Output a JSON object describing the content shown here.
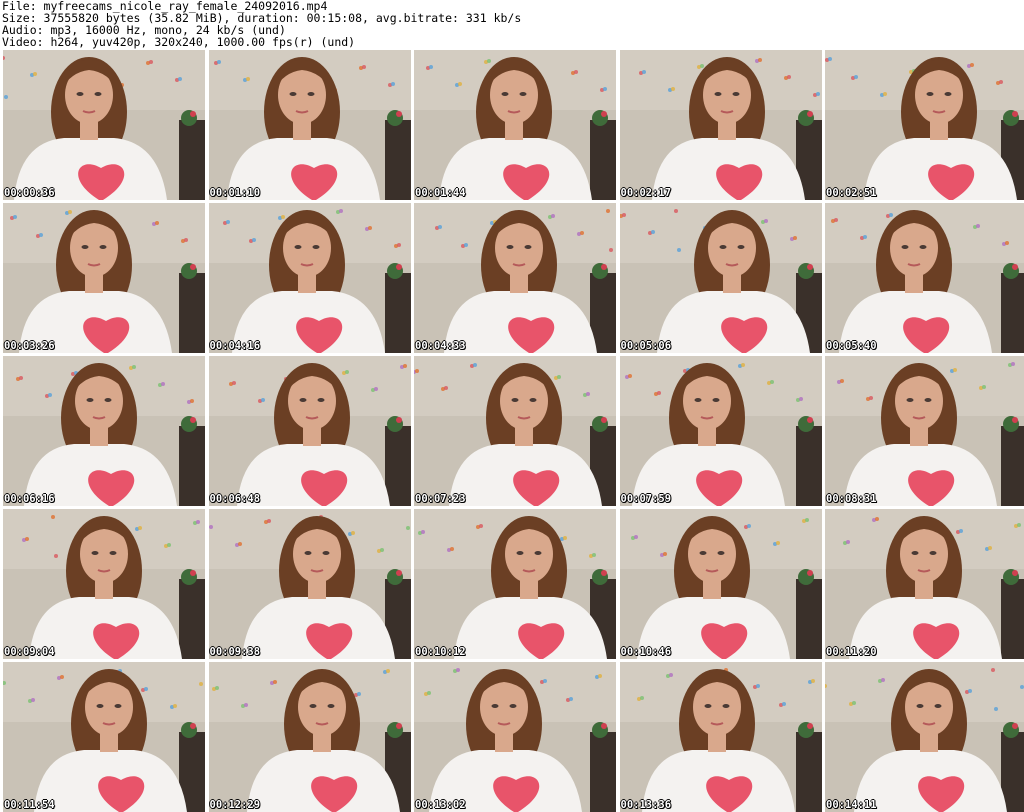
{
  "header": {
    "file": "File: myfreecams_nicole_ray_female_24092016.mp4",
    "size": "Size: 37555820 bytes (35.82 MiB), duration: 00:15:08, avg.bitrate: 331 kb/s",
    "audio": "Audio: mp3, 16000 Hz, mono, 24 kb/s (und)",
    "video": "Video: h264, yuv420p, 320x240, 1000.00 fps(r) (und)"
  },
  "thumbnails": [
    "00:00:36",
    "00:01:10",
    "00:01:44",
    "00:02:17",
    "00:02:51",
    "00:03:26",
    "00:04:16",
    "00:04:33",
    "00:05:06",
    "00:05:40",
    "00:06:16",
    "00:06:48",
    "00:07:23",
    "00:07:59",
    "00:08:31",
    "00:09:04",
    "00:09:38",
    "00:10:12",
    "00:10:46",
    "00:11:20",
    "00:11:54",
    "00:12:29",
    "00:13:02",
    "00:13:36",
    "00:14:11"
  ],
  "colors": {
    "wall": "#c9c2b6",
    "hair": "#6b3f24",
    "skin": "#d9a88c",
    "shirt": "#f4f2f0",
    "heart": "#e8546a"
  }
}
